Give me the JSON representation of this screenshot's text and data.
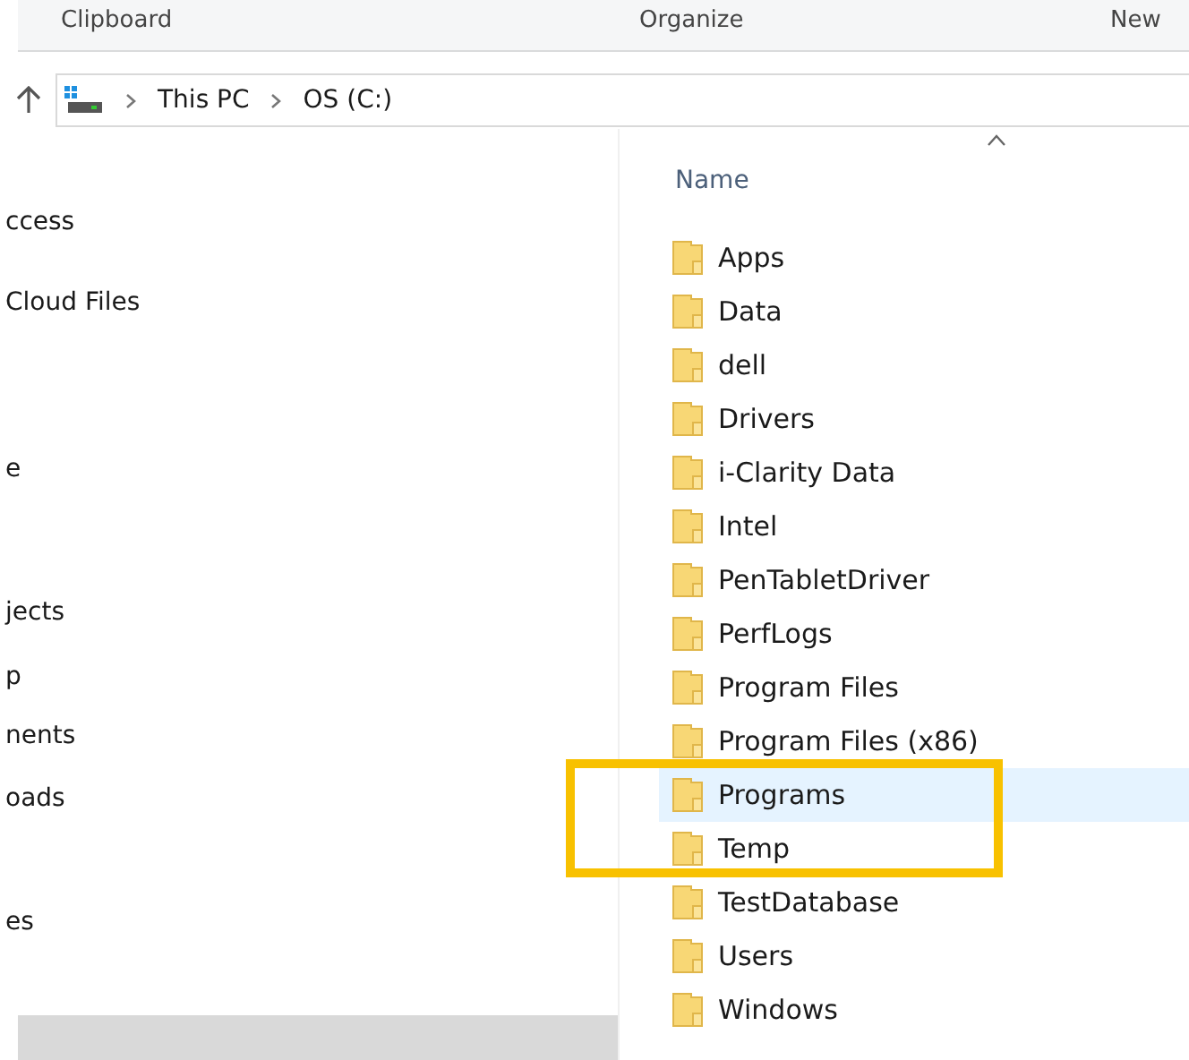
{
  "ribbon_groups": [
    "Clipboard",
    "Organize",
    "New"
  ],
  "address": {
    "crumbs": [
      "This PC",
      "OS (C:)"
    ]
  },
  "nav_items": [
    {
      "label": "ccess"
    },
    {
      "label": "Cloud Files"
    },
    {
      "label": "e"
    },
    {
      "label": "jects"
    },
    {
      "label": "p"
    },
    {
      "label": "nents"
    },
    {
      "label": "oads"
    },
    {
      "label": "es"
    }
  ],
  "file_list": {
    "column": "Name",
    "rows": [
      {
        "name": "Apps",
        "selected": false
      },
      {
        "name": "Data",
        "selected": false
      },
      {
        "name": "dell",
        "selected": false
      },
      {
        "name": "Drivers",
        "selected": false
      },
      {
        "name": "i-Clarity Data",
        "selected": false
      },
      {
        "name": "Intel",
        "selected": false
      },
      {
        "name": "PenTabletDriver",
        "selected": false
      },
      {
        "name": "PerfLogs",
        "selected": false
      },
      {
        "name": "Program Files",
        "selected": false
      },
      {
        "name": "Program Files (x86)",
        "selected": false
      },
      {
        "name": "Programs",
        "selected": true
      },
      {
        "name": "Temp",
        "selected": false
      },
      {
        "name": "TestDatabase",
        "selected": false
      },
      {
        "name": "Users",
        "selected": false
      },
      {
        "name": "Windows",
        "selected": false
      }
    ]
  }
}
